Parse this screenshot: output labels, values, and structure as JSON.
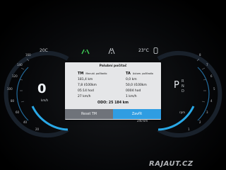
{
  "top": {
    "outside_temp": "20C",
    "car_temp": "23°C"
  },
  "left_gauge": {
    "speed": "0",
    "unit": "km/h",
    "ticks": [
      "160",
      "140",
      "120",
      "100",
      "80",
      "60",
      "40",
      "20"
    ]
  },
  "right_gauge": {
    "gear": "P",
    "gear_letters": [
      "R",
      "N",
      "D"
    ],
    "ticks": [
      "1",
      "2",
      "3",
      "4",
      "5",
      "6",
      "7",
      "8"
    ],
    "rpm_label": "rpm"
  },
  "dialog": {
    "title": "Palubní počítač",
    "left": {
      "code": "TM",
      "label": "Manuál. počítadlo",
      "values": [
        "181,4 km",
        "7,8 l/100km",
        "05:14 hod",
        "27 km/h"
      ]
    },
    "right": {
      "code": "TA",
      "label": "Autom. počítadlo",
      "values": [
        "0,0 km",
        "50,0 l/100km",
        "0004 hod",
        "1 km/h"
      ]
    },
    "odo": "ODO: 25 184 km",
    "reset_label": "Reset TM",
    "close_label": "Zavřít"
  },
  "bottom": {
    "range": "240 km"
  },
  "watermark": "RAJAUT.CZ"
}
